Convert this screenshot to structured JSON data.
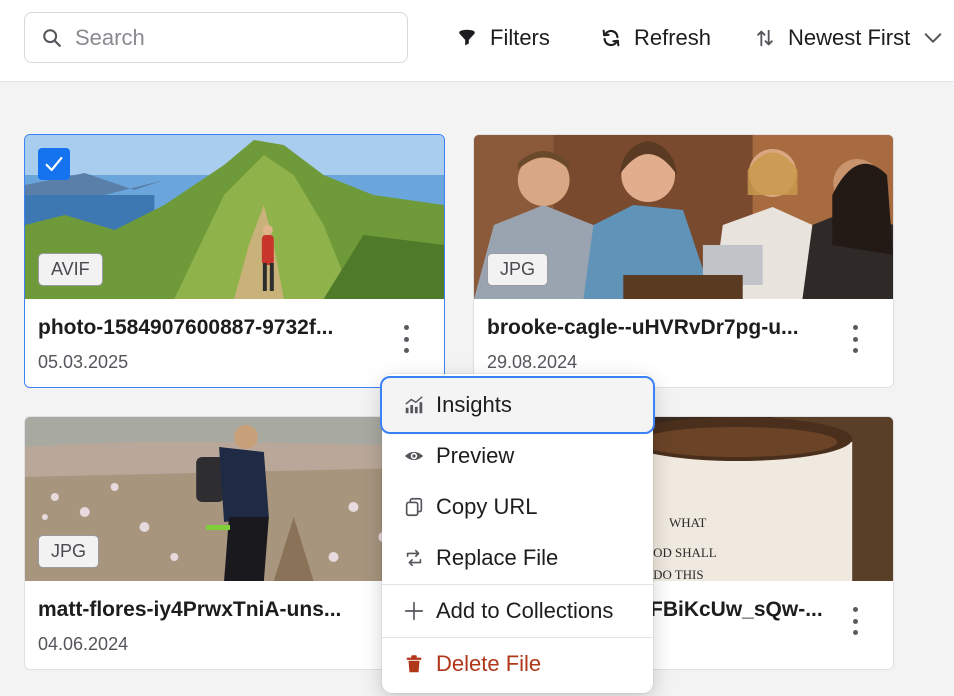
{
  "toolbar": {
    "search_placeholder": "Search",
    "filters_label": "Filters",
    "refresh_label": "Refresh",
    "sort_label": "Newest First"
  },
  "cards": [
    {
      "type": "AVIF",
      "name": "photo-1584907600887-9732f...",
      "date": "05.03.2025",
      "selected": true
    },
    {
      "type": "JPG",
      "name": "brooke-cagle--uHVRvDr7pg-u...",
      "date": "29.08.2024",
      "selected": false
    },
    {
      "type": "JPG",
      "name": "matt-flores-iy4PrwxTniA-uns...",
      "date": "04.06.2024",
      "selected": false
    },
    {
      "type": "",
      "name": "FBiKcUw_sQw-...",
      "date": "",
      "selected": false
    }
  ],
  "context_menu": {
    "items": [
      {
        "label": "Insights",
        "icon": "chart-icon"
      },
      {
        "label": "Preview",
        "icon": "eye-icon"
      },
      {
        "label": "Copy URL",
        "icon": "copy-icon"
      },
      {
        "label": "Replace File",
        "icon": "replace-icon"
      },
      {
        "label": "Add to Collections",
        "icon": "plus-icon"
      },
      {
        "label": "Delete File",
        "icon": "trash-icon"
      }
    ]
  },
  "colors": {
    "accent": "#3b82f6",
    "checkbox": "#1673f0",
    "danger": "#b0371a"
  }
}
